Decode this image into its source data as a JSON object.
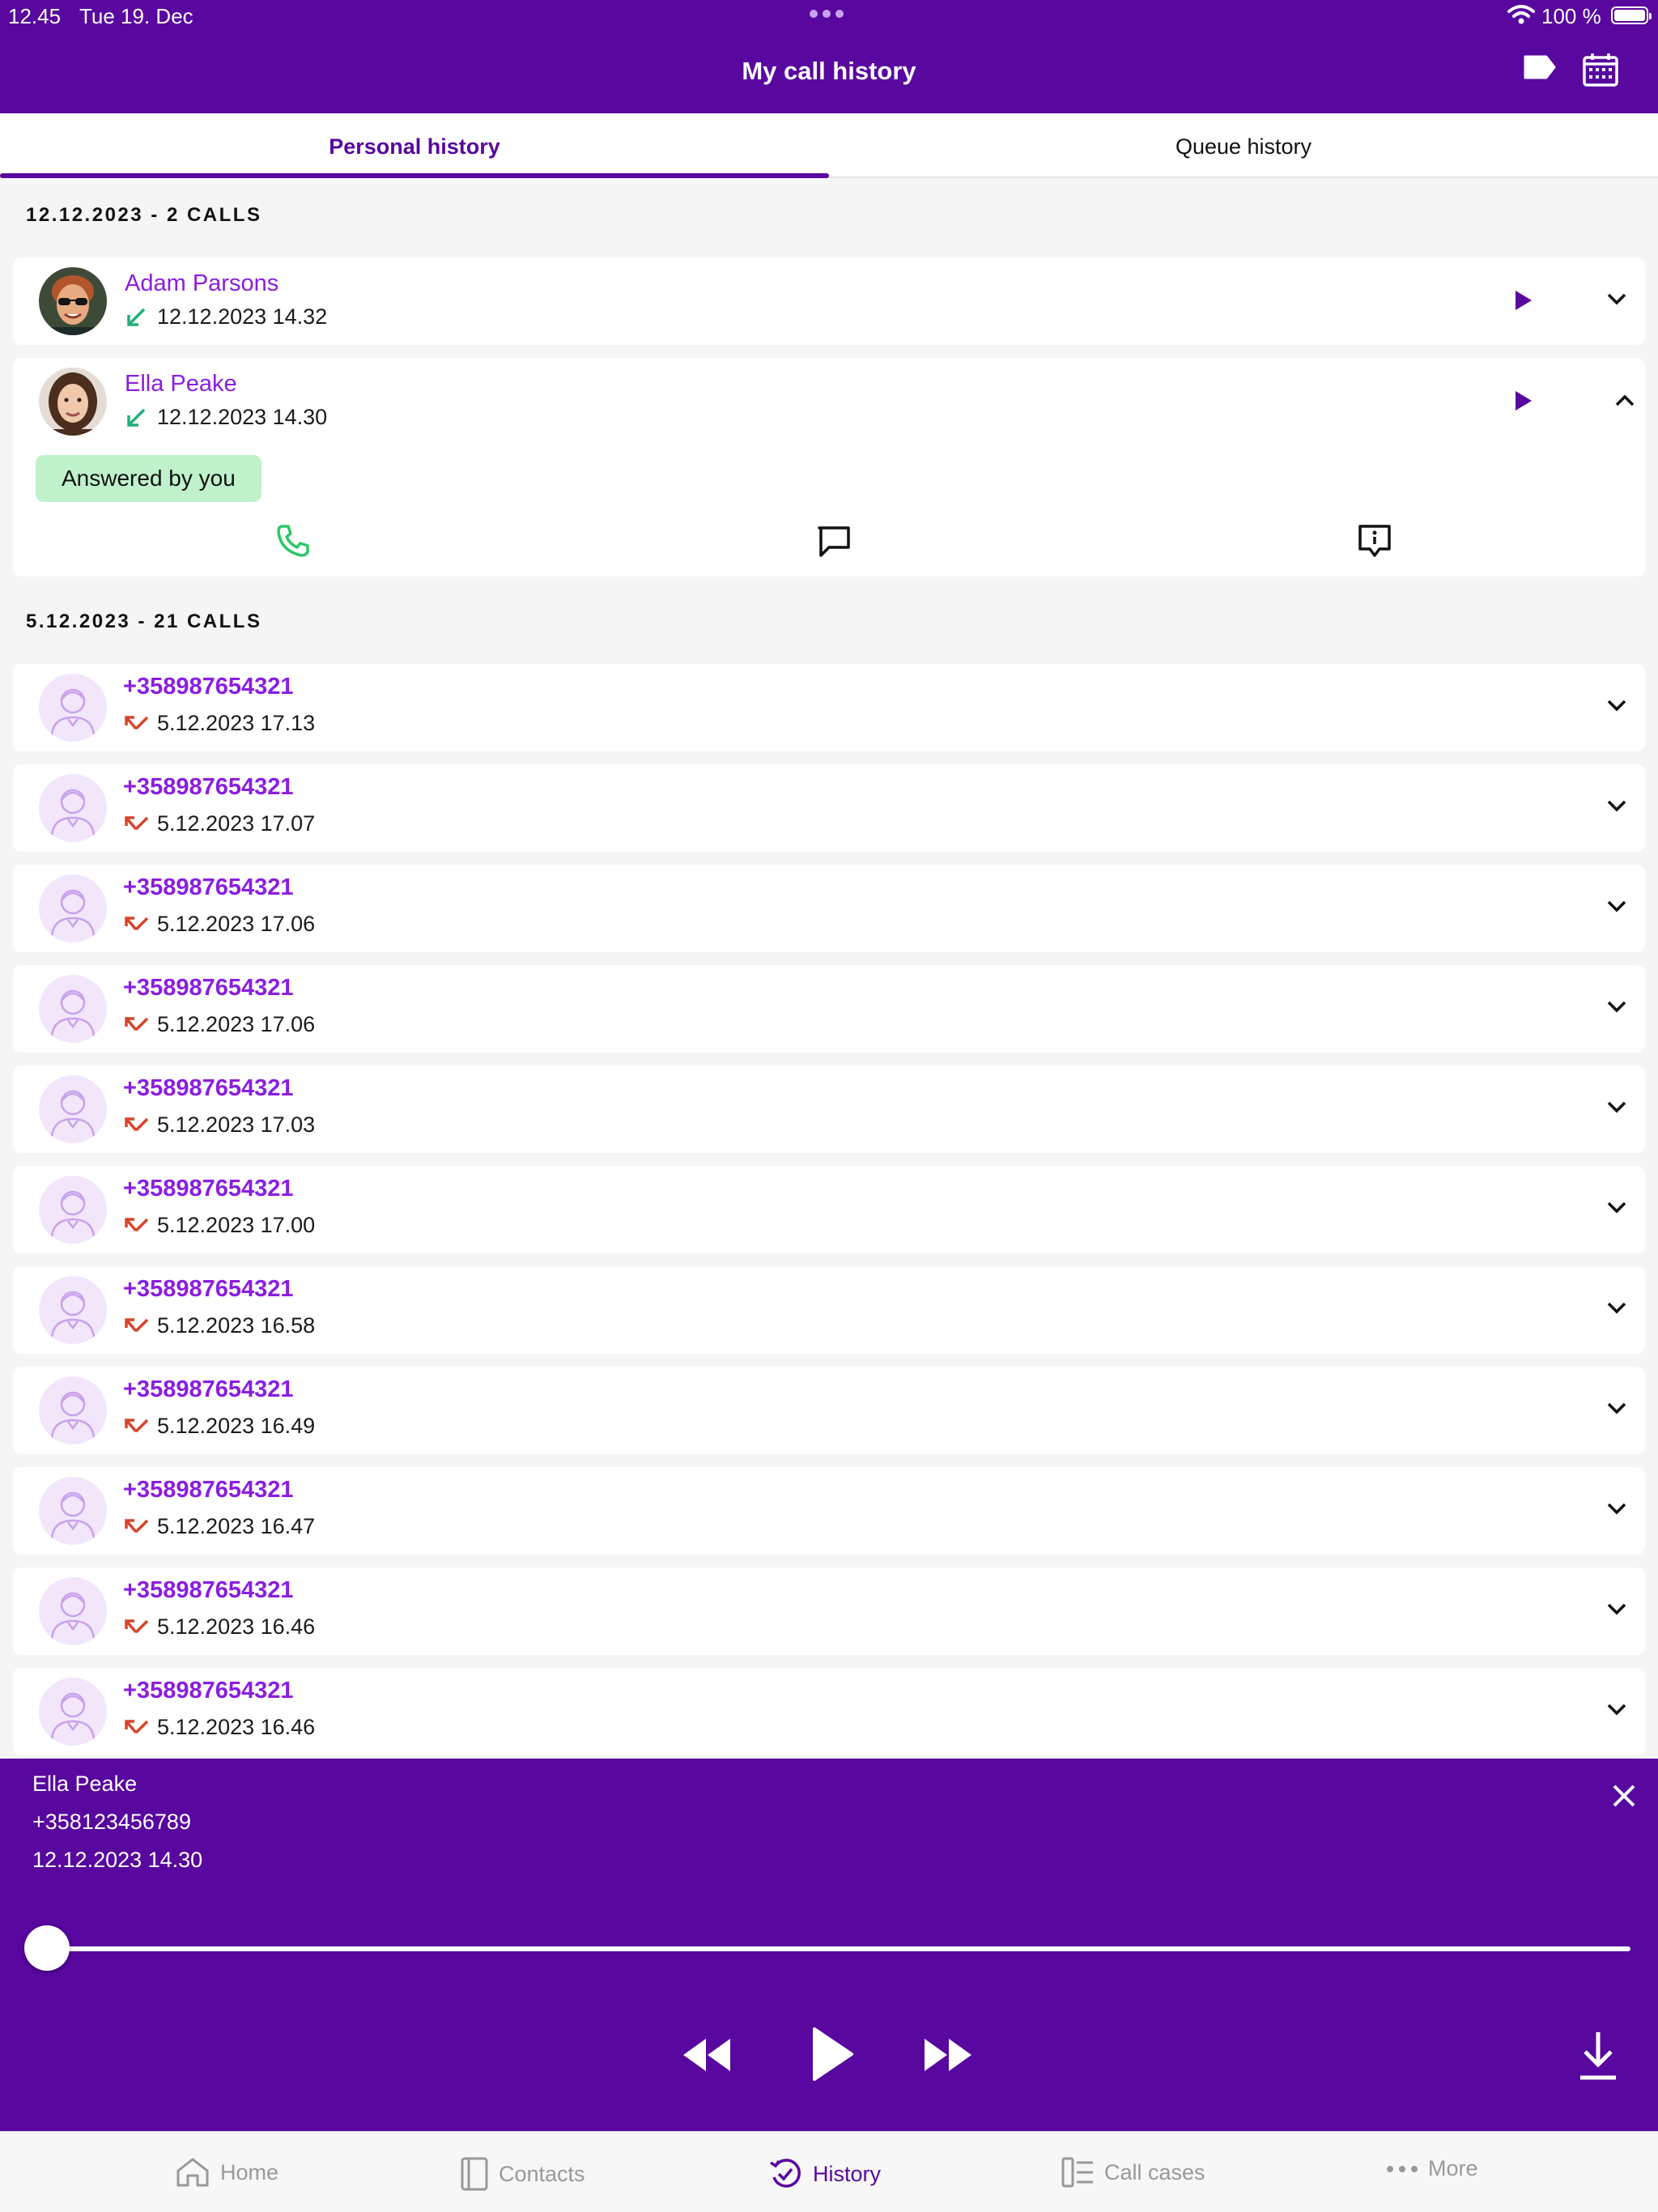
{
  "status_bar": {
    "time": "12.45",
    "date": "Tue 19. Dec",
    "battery": "100 %"
  },
  "header": {
    "title": "My call history",
    "tag_icon": "tag-icon",
    "calendar_icon": "calendar-icon"
  },
  "tabs": [
    {
      "label": "Personal history",
      "active": true
    },
    {
      "label": "Queue history",
      "active": false
    }
  ],
  "sections": [
    {
      "heading": "12.12.2023 - 2 CALLS",
      "calls": [
        {
          "name": "Adam Parsons",
          "datetime": "12.12.2023 14.32",
          "direction": "incoming-answered",
          "has_recording": true,
          "expanded": false
        },
        {
          "name": "Ella Peake",
          "datetime": "12.12.2023 14.30",
          "direction": "incoming-answered",
          "has_recording": true,
          "expanded": true,
          "badge": "Answered by you"
        }
      ]
    },
    {
      "heading": "5.12.2023 - 21 CALLS",
      "calls": [
        {
          "name": "+358987654321",
          "datetime": "5.12.2023 17.13",
          "direction": "missed"
        },
        {
          "name": "+358987654321",
          "datetime": "5.12.2023 17.07",
          "direction": "missed"
        },
        {
          "name": "+358987654321",
          "datetime": "5.12.2023 17.06",
          "direction": "missed"
        },
        {
          "name": "+358987654321",
          "datetime": "5.12.2023 17.06",
          "direction": "missed"
        },
        {
          "name": "+358987654321",
          "datetime": "5.12.2023 17.03",
          "direction": "missed"
        },
        {
          "name": "+358987654321",
          "datetime": "5.12.2023 17.00",
          "direction": "missed"
        },
        {
          "name": "+358987654321",
          "datetime": "5.12.2023 16.58",
          "direction": "missed"
        },
        {
          "name": "+358987654321",
          "datetime": "5.12.2023 16.49",
          "direction": "missed"
        },
        {
          "name": "+358987654321",
          "datetime": "5.12.2023 16.47",
          "direction": "missed"
        },
        {
          "name": "+358987654321",
          "datetime": "5.12.2023 16.46",
          "direction": "missed"
        },
        {
          "name": "+358987654321",
          "datetime": "5.12.2023 16.46",
          "direction": "missed"
        }
      ]
    }
  ],
  "player": {
    "name": "Ella Peake",
    "number": "+358123456789",
    "datetime": "12.12.2023 14.30",
    "progress": 0
  },
  "bottom_nav": [
    {
      "label": "Home",
      "icon": "home-icon",
      "active": false
    },
    {
      "label": "Contacts",
      "icon": "contacts-icon",
      "active": false
    },
    {
      "label": "History",
      "icon": "history-icon",
      "active": true
    },
    {
      "label": "Call cases",
      "icon": "call-cases-icon",
      "active": false
    },
    {
      "label": "More",
      "icon": "more-icon",
      "active": false
    }
  ],
  "colors": {
    "brand": "#58079f",
    "name": "#8a1ee0",
    "incoming": "#22b07a",
    "missed": "#d6452b",
    "badge": "#bff2cb"
  }
}
